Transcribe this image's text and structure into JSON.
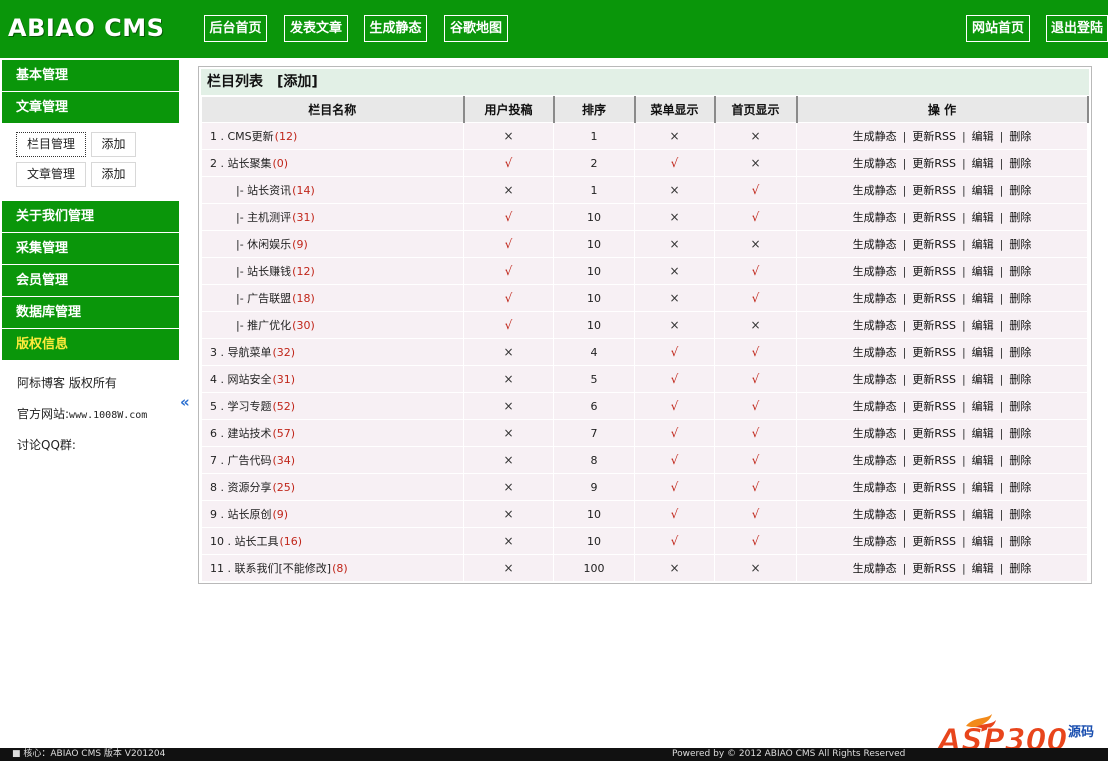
{
  "brand": {
    "logo": "ABIAO CMS"
  },
  "top_nav": {
    "left": [
      "后台首页",
      "发表文章",
      "生成静态",
      "谷歌地图"
    ],
    "right": [
      "网站首页",
      "退出登陆"
    ]
  },
  "sidebar": {
    "sections_top": [
      "基本管理",
      "文章管理"
    ],
    "sub_items": [
      {
        "label": "栏目管理",
        "action": "添加"
      },
      {
        "label": "文章管理",
        "action": "添加"
      }
    ],
    "sections_bottom": [
      "关于我们管理",
      "采集管理",
      "会员管理",
      "数据库管理"
    ],
    "copyright_head": "版权信息",
    "copyright_lines": {
      "owner": "阿标博客 版权所有",
      "site_label": "官方网站:",
      "site_url": "www.1008W.com",
      "qq": "讨论QQ群:"
    },
    "collapse_glyph": "«"
  },
  "panel": {
    "title": "栏目列表",
    "add_link": "[添加]",
    "columns": [
      "栏目名称",
      "用户投稿",
      "排序",
      "菜单显示",
      "首页显示",
      "操 作"
    ],
    "operations": [
      "生成静态",
      "更新RSS",
      "编辑",
      "删除"
    ],
    "rows": [
      {
        "name": "1 . CMS更新",
        "count": "(12)",
        "user": "×",
        "order": "1",
        "menu": "×",
        "home": "×"
      },
      {
        "name": "2 . 站长聚集",
        "count": "(0)",
        "user": "√",
        "order": "2",
        "menu": "√",
        "home": "×"
      },
      {
        "name": "|- 站长资讯",
        "count": "(14)",
        "user": "×",
        "order": "1",
        "menu": "×",
        "home": "√",
        "child": true
      },
      {
        "name": "|- 主机测评",
        "count": "(31)",
        "user": "√",
        "order": "10",
        "menu": "×",
        "home": "√",
        "child": true
      },
      {
        "name": "|- 休闲娱乐",
        "count": "(9)",
        "user": "√",
        "order": "10",
        "menu": "×",
        "home": "×",
        "child": true
      },
      {
        "name": "|- 站长赚钱",
        "count": "(12)",
        "user": "√",
        "order": "10",
        "menu": "×",
        "home": "√",
        "child": true
      },
      {
        "name": "|- 广告联盟",
        "count": "(18)",
        "user": "√",
        "order": "10",
        "menu": "×",
        "home": "√",
        "child": true
      },
      {
        "name": "|- 推广优化",
        "count": "(30)",
        "user": "√",
        "order": "10",
        "menu": "×",
        "home": "×",
        "child": true
      },
      {
        "name": "3 . 导航菜单",
        "count": "(32)",
        "user": "×",
        "order": "4",
        "menu": "√",
        "home": "√"
      },
      {
        "name": "4 . 网站安全",
        "count": "(31)",
        "user": "×",
        "order": "5",
        "menu": "√",
        "home": "√"
      },
      {
        "name": "5 . 学习专题",
        "count": "(52)",
        "user": "×",
        "order": "6",
        "menu": "√",
        "home": "√"
      },
      {
        "name": "6 . 建站技术",
        "count": "(57)",
        "user": "×",
        "order": "7",
        "menu": "√",
        "home": "√"
      },
      {
        "name": "7 . 广告代码",
        "count": "(34)",
        "user": "×",
        "order": "8",
        "menu": "√",
        "home": "√"
      },
      {
        "name": "8 . 资源分享",
        "count": "(25)",
        "user": "×",
        "order": "9",
        "menu": "√",
        "home": "√"
      },
      {
        "name": "9 . 站长原创",
        "count": "(9)",
        "user": "×",
        "order": "10",
        "menu": "√",
        "home": "√"
      },
      {
        "name": "10 . 站长工具",
        "count": "(16)",
        "user": "×",
        "order": "10",
        "menu": "√",
        "home": "√"
      },
      {
        "name": "11 . 联系我们[不能修改]",
        "count": "(8)",
        "user": "×",
        "order": "100",
        "menu": "×",
        "home": "×"
      }
    ]
  },
  "status_bar": {
    "left": "核心：ABIAO CMS 版本 V201204",
    "right": "Powered by © 2012 ABIAO CMS All Rights Reserved"
  },
  "watermark": {
    "text": "ASP300",
    "suffix": "源码"
  },
  "colors": {
    "brand_green": "#0a960a",
    "title_bg": "#e2f0e6",
    "row_bg": "#f7f0f4",
    "count_red": "#c0261a",
    "copyright_yellow": "#ffeb3b"
  },
  "icons": {
    "collapse": "double-chevron-left-icon",
    "status": "monitor-icon"
  }
}
